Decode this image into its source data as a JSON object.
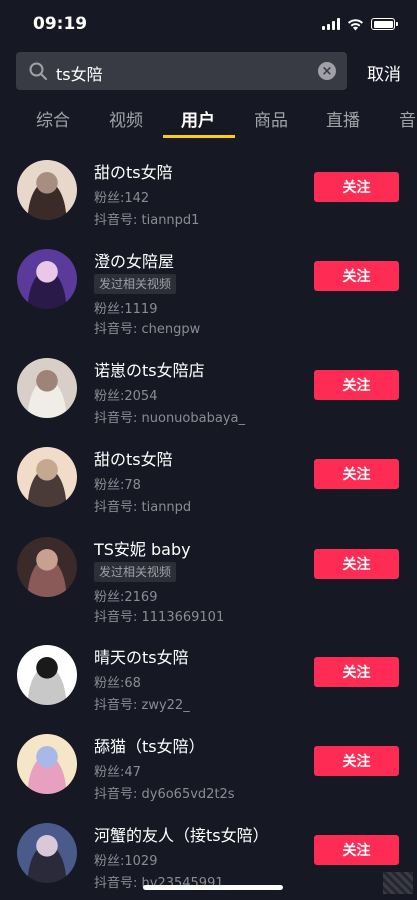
{
  "status_bar": {
    "time": "09:19"
  },
  "search": {
    "query": "ts女陪",
    "cancel_label": "取消"
  },
  "tabs": [
    "综合",
    "视频",
    "用户",
    "商品",
    "直播",
    "音"
  ],
  "active_tab": "用户",
  "users": [
    {
      "name": "甜のts女陪",
      "tag": "",
      "fans": "粉丝:142",
      "account": "抖音号: tiannpd1",
      "follow": "关注",
      "avatar_colors": [
        "#e8d8cc",
        "#a88e80",
        "#3a2a28"
      ]
    },
    {
      "name": "澄の女陪屋",
      "tag": "发过相关视频",
      "fans": "粉丝:1119",
      "account": "抖音号: chengpw",
      "follow": "关注",
      "avatar_colors": [
        "#5a3a9a",
        "#e9c7e6",
        "#2a1a4a"
      ]
    },
    {
      "name": "诺崽のts女陪店",
      "tag": "",
      "fans": "粉丝:2054",
      "account": "抖音号: nuonuobabaya_",
      "follow": "关注",
      "avatar_colors": [
        "#d8d0c8",
        "#9c8478",
        "#f0ece6"
      ]
    },
    {
      "name": "甜のts女陪",
      "tag": "",
      "fans": "粉丝:78",
      "account": "抖音号: tiannpd",
      "follow": "关注",
      "avatar_colors": [
        "#f0dcc8",
        "#c4a890",
        "#4a3a38"
      ]
    },
    {
      "name": "TS安妮 baby",
      "tag": "发过相关视频",
      "fans": "粉丝:2169",
      "account": "抖音号: 1113669101",
      "follow": "关注",
      "avatar_colors": [
        "#3a2a2a",
        "#c8a090",
        "#8a5a58"
      ]
    },
    {
      "name": "晴天のts女陪",
      "tag": "",
      "fans": "粉丝:68",
      "account": "抖音号: zwy22_",
      "follow": "关注",
      "avatar_colors": [
        "#ffffff",
        "#1a1a1a",
        "#c8c8c8"
      ]
    },
    {
      "name": "舔猫（ts女陪）",
      "tag": "",
      "fans": "粉丝:47",
      "account": "抖音号: dy6o65vd2t2s",
      "follow": "关注",
      "avatar_colors": [
        "#f5e6c8",
        "#a8b8e8",
        "#e8a0c0"
      ]
    },
    {
      "name": "河蟹的友人（接ts女陪）",
      "tag": "",
      "fans": "粉丝:1029",
      "account": "抖音号: hy23545991",
      "follow": "关注",
      "avatar_colors": [
        "#4a5a8a",
        "#d8c8d8",
        "#2a2a3a"
      ]
    }
  ]
}
